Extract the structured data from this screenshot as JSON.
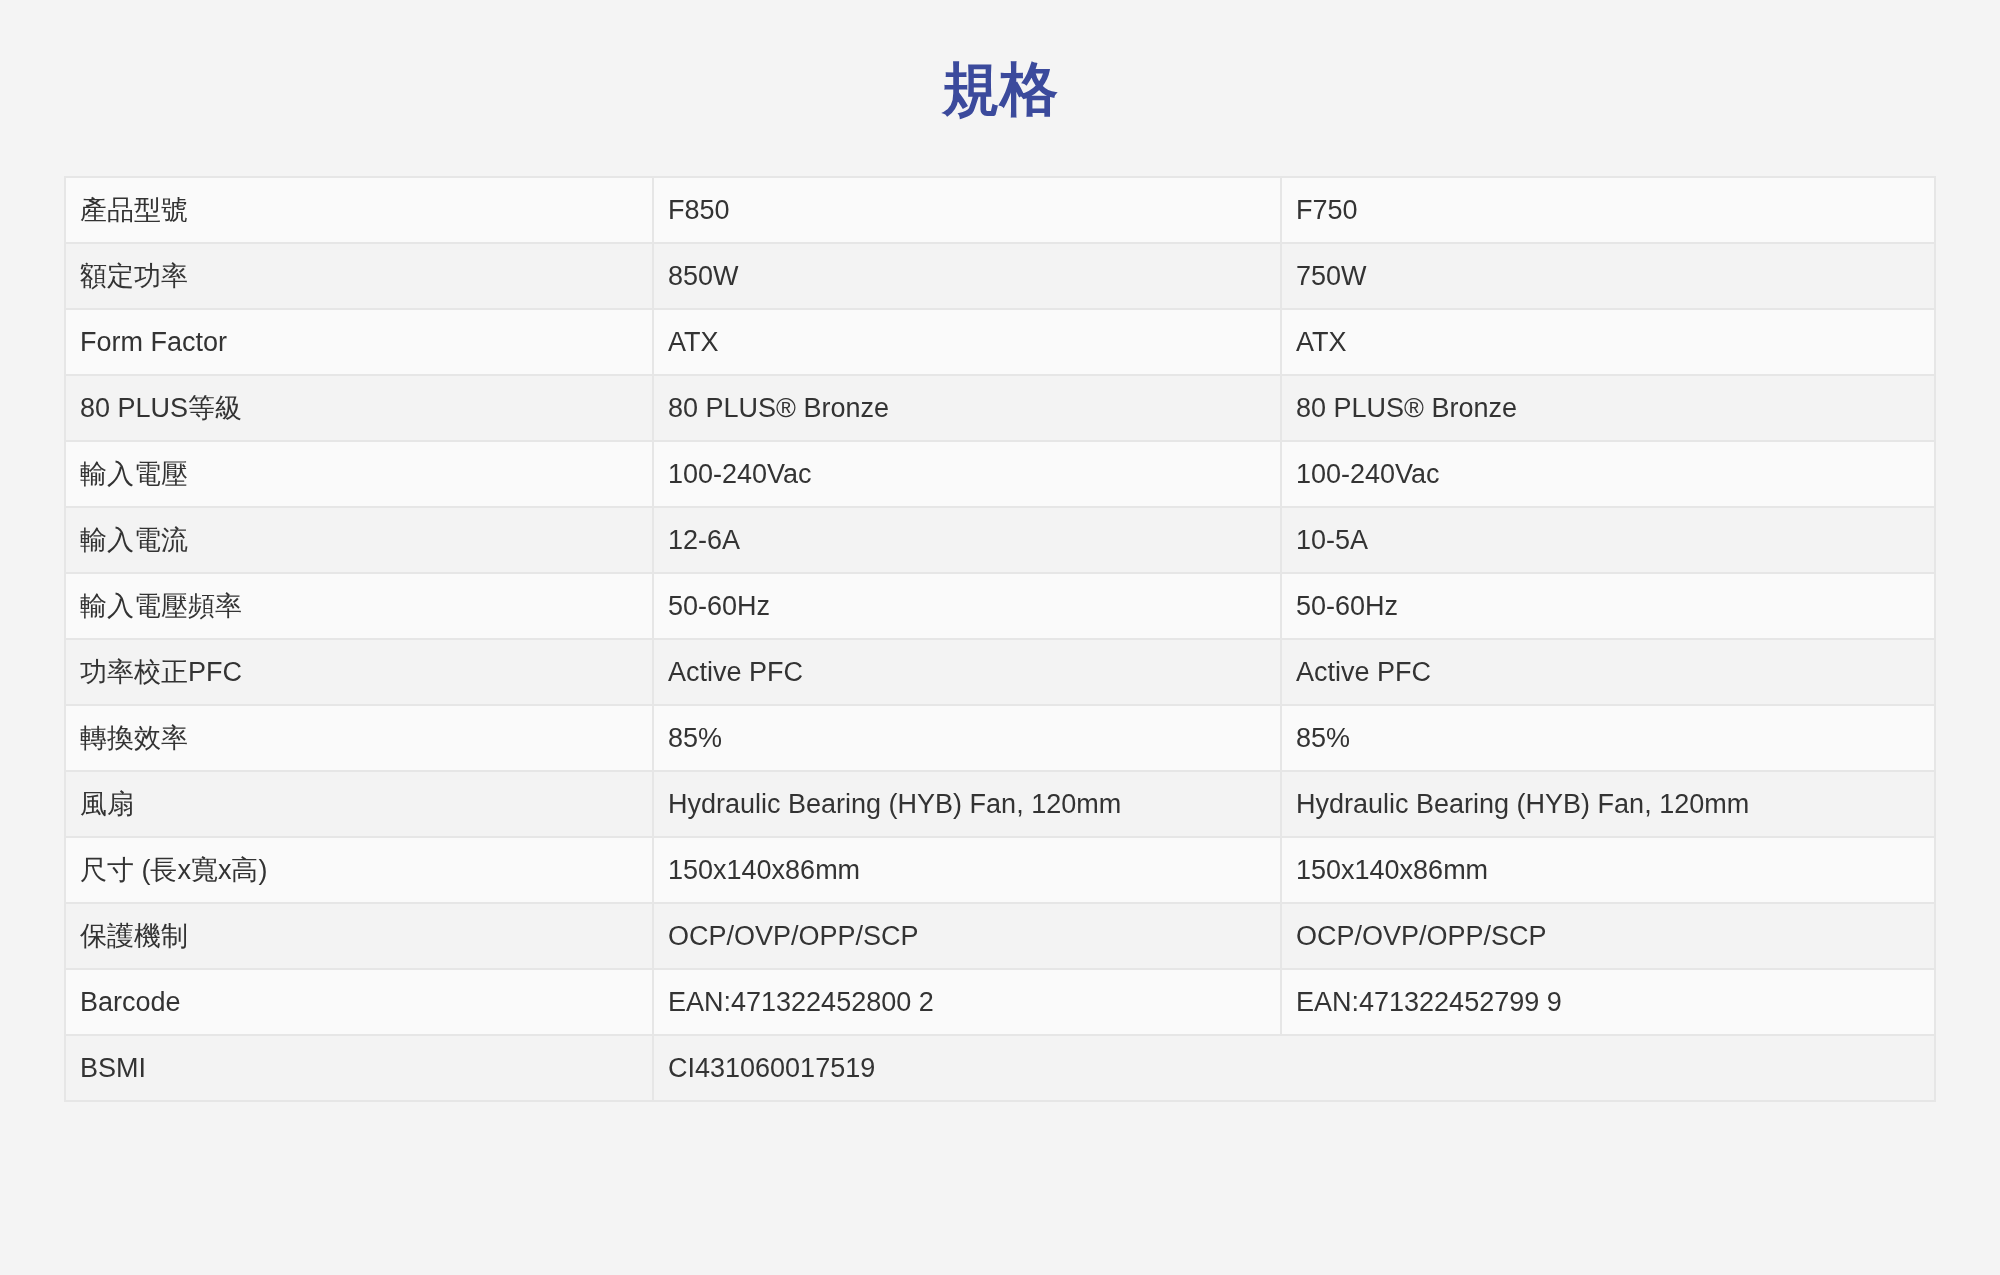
{
  "title": "規格",
  "table": {
    "rows": [
      {
        "label": "產品型號",
        "values": [
          "F850",
          "F750"
        ]
      },
      {
        "label": "額定功率",
        "values": [
          "850W",
          "750W"
        ]
      },
      {
        "label": "Form Factor",
        "values": [
          "ATX",
          "ATX"
        ]
      },
      {
        "label": "80 PLUS等級",
        "values": [
          "80 PLUS® Bronze",
          "80 PLUS® Bronze"
        ]
      },
      {
        "label": "輸入電壓",
        "values": [
          "100-240Vac",
          "100-240Vac"
        ]
      },
      {
        "label": "輸入電流",
        "values": [
          "12-6A",
          "10-5A"
        ]
      },
      {
        "label": "輸入電壓頻率",
        "values": [
          "50-60Hz",
          "50-60Hz"
        ]
      },
      {
        "label": "功率校正PFC",
        "values": [
          "Active PFC",
          "Active PFC"
        ]
      },
      {
        "label": "轉換效率",
        "values": [
          "85%",
          "85%"
        ]
      },
      {
        "label": "風扇",
        "values": [
          "Hydraulic Bearing (HYB) Fan, 120mm",
          "Hydraulic Bearing (HYB) Fan, 120mm"
        ]
      },
      {
        "label": "尺寸 (長x寬x高)",
        "values": [
          "150x140x86mm",
          "150x140x86mm"
        ]
      },
      {
        "label": "保護機制",
        "values": [
          "OCP/OVP/OPP/SCP",
          "OCP/OVP/OPP/SCP"
        ]
      },
      {
        "label": "Barcode",
        "values": [
          "EAN:471322452800 2",
          "EAN:471322452799 9"
        ]
      },
      {
        "label": "BSMI",
        "values": [
          "CI431060017519"
        ]
      }
    ]
  }
}
